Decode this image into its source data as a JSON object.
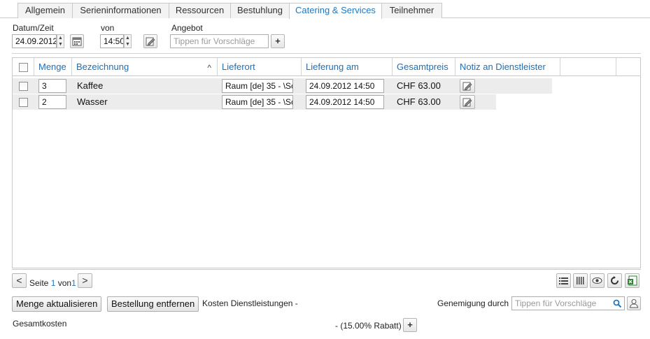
{
  "tabs": [
    {
      "label": "Allgemein",
      "active": false
    },
    {
      "label": "Serieninformationen",
      "active": false
    },
    {
      "label": "Ressourcen",
      "active": false
    },
    {
      "label": "Bestuhlung",
      "active": false
    },
    {
      "label": "Catering & Services",
      "active": true
    },
    {
      "label": "Teilnehmer",
      "active": false
    }
  ],
  "form": {
    "date_label": "Datum/Zeit",
    "date_value": "24.09.2012",
    "from_label": "von",
    "time_value": "14:50",
    "offer_label": "Angebot",
    "offer_placeholder": "Tippen für Vorschläge",
    "add_symbol": "+"
  },
  "grid": {
    "columns": [
      "Menge",
      "Bezeichnung",
      "Lieferort",
      "Lieferung am",
      "Gesamtpreis",
      "Notiz an Dienstleister"
    ],
    "sort_indicator": "^",
    "rows": [
      {
        "menge": "3",
        "bezeichnung": "Kaffee",
        "lieferort": "Raum [de] 35 - \\Sc",
        "lieferung_am": "24.09.2012 14:50",
        "gesamtpreis": "CHF 63.00"
      },
      {
        "menge": "2",
        "bezeichnung": "Wasser",
        "lieferort": "Raum [de] 35 - \\Sc",
        "lieferung_am": "24.09.2012 14:50",
        "gesamtpreis": "CHF 63.00"
      }
    ]
  },
  "pager": {
    "prev": "<",
    "next": ">",
    "page_label": "Seite",
    "page_current": "1",
    "of_label": "von",
    "page_total": "1"
  },
  "actions": {
    "update_qty": "Menge aktualisieren",
    "remove_order": "Bestellung entfernen",
    "service_costs": "Kosten Dienstleistungen -",
    "approval_label": "Genemigung durch",
    "approval_placeholder": "Tippen für Vorschläge"
  },
  "totals": {
    "label": "Gesamtkosten",
    "discount": "-  (15.00% Rabatt)",
    "add_symbol": "+"
  },
  "colors": {
    "accent": "#1f78c1",
    "row_bg": "#ececec"
  }
}
